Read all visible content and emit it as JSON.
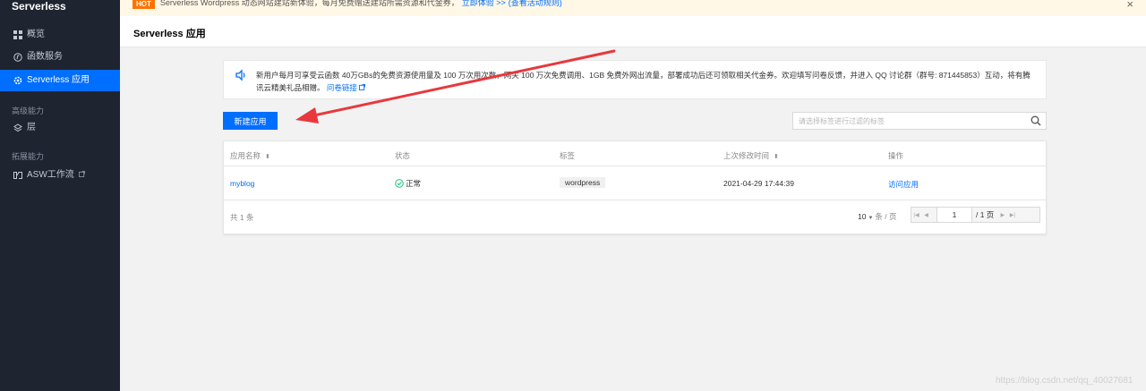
{
  "sidebar": {
    "title": "Serverless",
    "items": [
      {
        "label": "概览",
        "icon": "grid-icon"
      },
      {
        "label": "函数服务",
        "icon": "function-icon"
      },
      {
        "label": "Serverless 应用",
        "icon": "gear-icon"
      }
    ],
    "section_advanced": "高级能力",
    "advanced_items": [
      {
        "label": "层",
        "icon": "layers-icon"
      }
    ],
    "section_extension": "拓展能力",
    "extension_items": [
      {
        "label": "ASW工作流",
        "icon": "workflow-icon"
      }
    ]
  },
  "topbar": {
    "badge": "HOT",
    "text": "Serverless Wordpress 动态网站建站新体验，每月免费赠送建站所需资源和代金券，",
    "link1": "立即体验 >>",
    "link2": "(查看活动规则)"
  },
  "header": {
    "title": "Serverless 应用"
  },
  "notice": {
    "text": "新用户每月可享受云函数 40万GBs的免费资源使用量及 100 万次用次数，网关 100 万次免费调用、1GB 免费外网出流量，部署成功后还可领取相关代金券。欢迎填写问卷反馈，并进入 QQ 讨论群（群号: 871445853）互动，将有腾讯云精美礼品相赠。",
    "link": "问卷链接"
  },
  "toolbar": {
    "new_button": "新建应用",
    "search_placeholder": "请选择标签进行过滤的标签"
  },
  "table": {
    "columns": [
      "应用名称",
      "状态",
      "标签",
      "上次修改时间",
      "操作"
    ],
    "rows": [
      {
        "name": "myblog",
        "status": "正常",
        "tag": "wordpress",
        "modified": "2021-04-29 17:44:39",
        "action": "访问应用"
      }
    ],
    "total_label": "共 1 条",
    "page_size": "10",
    "page_size_unit": "条 / 页",
    "current_page": "1",
    "total_pages": "/ 1 页"
  },
  "watermark": "https://blog.csdn.net/qq_40027681",
  "colors": {
    "sidebar_bg": "#1e2430",
    "accent": "#006eff",
    "success": "#29cc85",
    "annotation_arrow": "#e8383d"
  }
}
